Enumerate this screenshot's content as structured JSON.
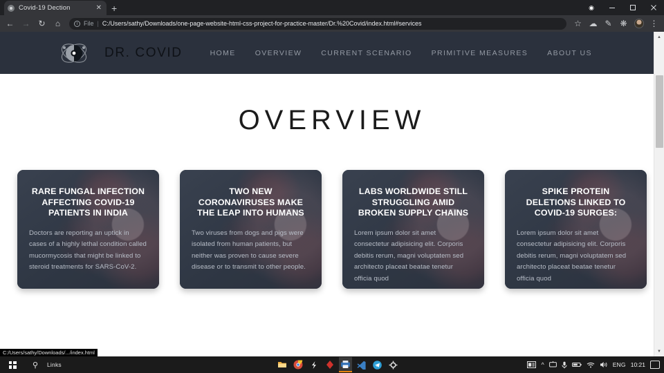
{
  "browser": {
    "tab": {
      "title": "Covid-19 Dection",
      "favicon_icon": "virus-favicon",
      "close_icon": "close-icon"
    },
    "new_tab_icon": "plus-icon",
    "window_controls": {
      "record_icon": "record-dot-icon",
      "minimize_icon": "minimize-icon",
      "maximize_icon": "maximize-icon",
      "close_icon": "close-icon"
    },
    "toolbar": {
      "back_icon": "back-arrow-icon",
      "forward_icon": "forward-arrow-icon",
      "reload_icon": "reload-icon",
      "home_icon": "home-icon",
      "info_icon": "info-icon",
      "scheme_label": "File",
      "separator": "|",
      "url": "C:/Users/sathy/Downloads/one-page-website-html-css-project-for-practice-master/Dr.%20Covid/index.html#services",
      "bookmark_icon": "star-icon",
      "extension_cloud_icon": "cloud-extension-icon",
      "extension_pen_icon": "pen-extension-icon",
      "extensions_icon": "puzzle-piece-icon",
      "profile_icon": "avatar-icon",
      "menu_icon": "three-dot-menu-icon"
    },
    "status_bubble": "C:/Users/sathy/Downloads/.../index.html",
    "scrollbar": {
      "up_icon": "scroll-up-arrow",
      "down_icon": "scroll-down-arrow"
    }
  },
  "site": {
    "nav": {
      "logo_icon": "virus-logo-icon",
      "brand": "DR. COVID",
      "links": [
        {
          "label": "HOME"
        },
        {
          "label": "OVERVIEW"
        },
        {
          "label": "CURRENT SCENARIO"
        },
        {
          "label": "PRIMITIVE MEASURES"
        },
        {
          "label": "ABOUT US"
        }
      ],
      "bg_color": "#2b313d",
      "brand_color": "#0e1116",
      "link_color": "#949aa4"
    },
    "overview": {
      "heading": "OVERVIEW",
      "cards": [
        {
          "title": "RARE FUNGAL INFECTION AFFECTING COVID-19 PATIENTS IN INDIA",
          "body": "Doctors are reporting an uptick in cases of a highly lethal condition called mucormycosis that might be linked to steroid treatments for SARS-CoV-2."
        },
        {
          "title": "TWO NEW CORONAVIRUSES MAKE THE LEAP INTO HUMANS",
          "body": "Two viruses from dogs and pigs were isolated from human patients, but neither was proven to cause severe disease or to transmit to other people."
        },
        {
          "title": "LABS WORLDWIDE STILL STRUGGLING AMID BROKEN SUPPLY CHAINS",
          "body": "Lorem ipsum dolor sit amet consectetur adipisicing elit. Corporis debitis rerum, magni voluptatem sed architecto placeat beatae tenetur officia quod"
        },
        {
          "title": "SPIKE PROTEIN DELETIONS LINKED TO COVID-19 SURGES:",
          "body": "Lorem ipsum dolor sit amet consectetur adipisicing elit. Corporis debitis rerum, magni voluptatem sed architecto placeat beatae tenetur officia quod"
        }
      ],
      "card_bg_color": "#333b49",
      "card_title_color": "#ffffff",
      "card_body_color": "#b9bfc9"
    }
  },
  "taskbar": {
    "start_icon": "windows-start-icon",
    "search_icon": "search-icon",
    "links_label": "Links",
    "apps": [
      {
        "name": "file-explorer-icon"
      },
      {
        "name": "chrome-icon"
      },
      {
        "name": "script-icon"
      },
      {
        "name": "ruby-diamond-icon"
      },
      {
        "name": "active-app-icon"
      },
      {
        "name": "vscode-icon"
      },
      {
        "name": "telegram-icon"
      },
      {
        "name": "settings-gear-icon"
      }
    ],
    "tray": {
      "news_icon": "news-weather-icon",
      "overflow_icon": "chevron-up-icon",
      "display_icon": "display-icon",
      "mic_icon": "microphone-icon",
      "battery_icon": "battery-icon",
      "wifi_icon": "wifi-icon",
      "volume_icon": "volume-icon",
      "language": "ENG",
      "clock": "10:21",
      "action_center_icon": "action-center-icon"
    }
  }
}
